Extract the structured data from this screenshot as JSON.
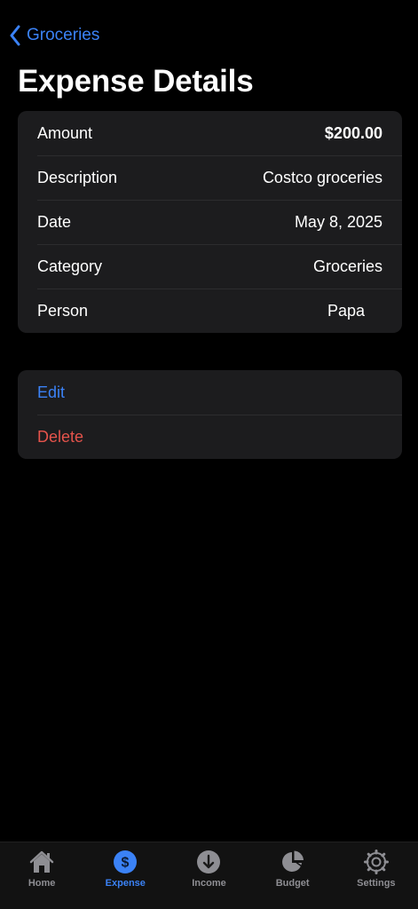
{
  "nav": {
    "back_label": "Groceries"
  },
  "title": "Expense Details",
  "details": [
    {
      "label": "Amount",
      "value": "$200.00"
    },
    {
      "label": "Description",
      "value": "Costco groceries"
    },
    {
      "label": "Date",
      "value": "May 8, 2025"
    },
    {
      "label": "Category",
      "value": "Groceries"
    },
    {
      "label": "Person",
      "value": "Papa"
    }
  ],
  "actions": {
    "edit_label": "Edit",
    "delete_label": "Delete"
  },
  "tabbar": {
    "tabs": [
      {
        "label": "Home",
        "icon": "house-icon"
      },
      {
        "label": "Expense",
        "icon": "dollar-circle-icon",
        "active": true
      },
      {
        "label": "Income",
        "icon": "arrow-down-circle-icon"
      },
      {
        "label": "Budget",
        "icon": "pie-chart-icon"
      },
      {
        "label": "Settings",
        "icon": "gear-icon"
      }
    ]
  },
  "colors": {
    "accent": "#3b82f6",
    "destructive": "#e5534b",
    "card_bg": "#1c1c1e",
    "background": "#000000",
    "inactive": "#8e8e93"
  }
}
